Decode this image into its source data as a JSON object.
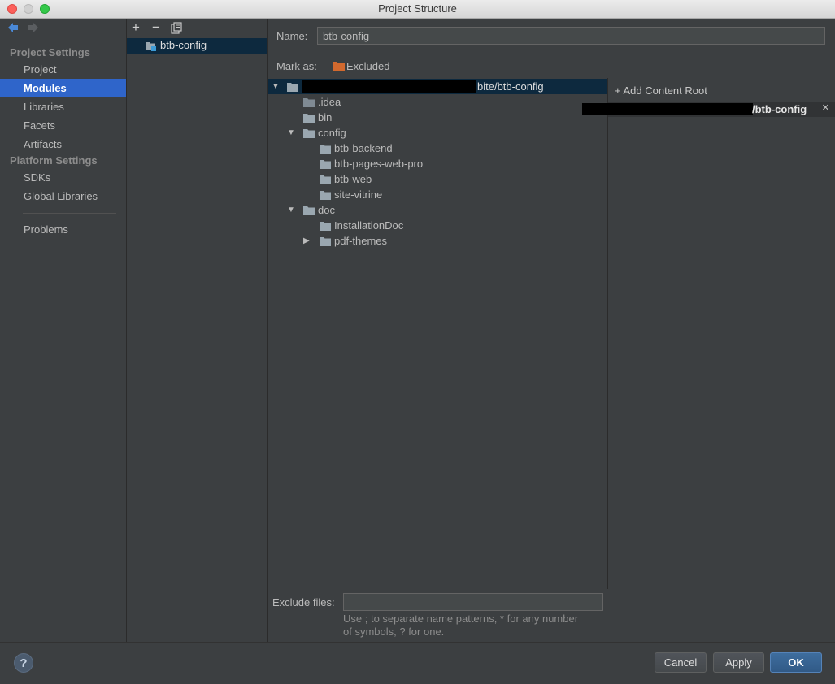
{
  "window": {
    "title": "Project Structure"
  },
  "sidebar": {
    "project_settings_header": "Project Settings",
    "project_items": [
      "Project",
      "Modules",
      "Libraries",
      "Facets",
      "Artifacts"
    ],
    "platform_settings_header": "Platform Settings",
    "platform_items": [
      "SDKs",
      "Global Libraries"
    ],
    "problems": "Problems",
    "selected": "Modules"
  },
  "module_list": {
    "toolbar": {
      "add": "+",
      "remove": "−"
    },
    "items": [
      "btb-config"
    ]
  },
  "module": {
    "name_label": "Name:",
    "name_value": "btb-config",
    "mark_as_label": "Mark as:",
    "mark_as_value": "Excluded"
  },
  "tree": {
    "root_suffix": "bite/btb-config",
    "nodes": [
      ".idea",
      "bin",
      "config",
      "btb-backend",
      "btb-pages-web-pro",
      "btb-web",
      "site-vitrine",
      "doc",
      "InstallationDoc",
      "pdf-themes"
    ]
  },
  "content_root": {
    "add_label": "+ Add Content Root",
    "path_suffix": "/btb-config",
    "close": "×"
  },
  "exclude": {
    "label": "Exclude files:",
    "value": "",
    "hint_line1": "Use ; to separate name patterns, * for any number",
    "hint_line2": "of symbols, ? for one."
  },
  "footer": {
    "help": "?",
    "cancel": "Cancel",
    "apply": "Apply",
    "ok": "OK"
  },
  "colors": {
    "selection": "#2f65ca",
    "tree_selection": "#0d293e",
    "excluded_folder": "#d2692e",
    "folder": "#9aa7b0"
  }
}
